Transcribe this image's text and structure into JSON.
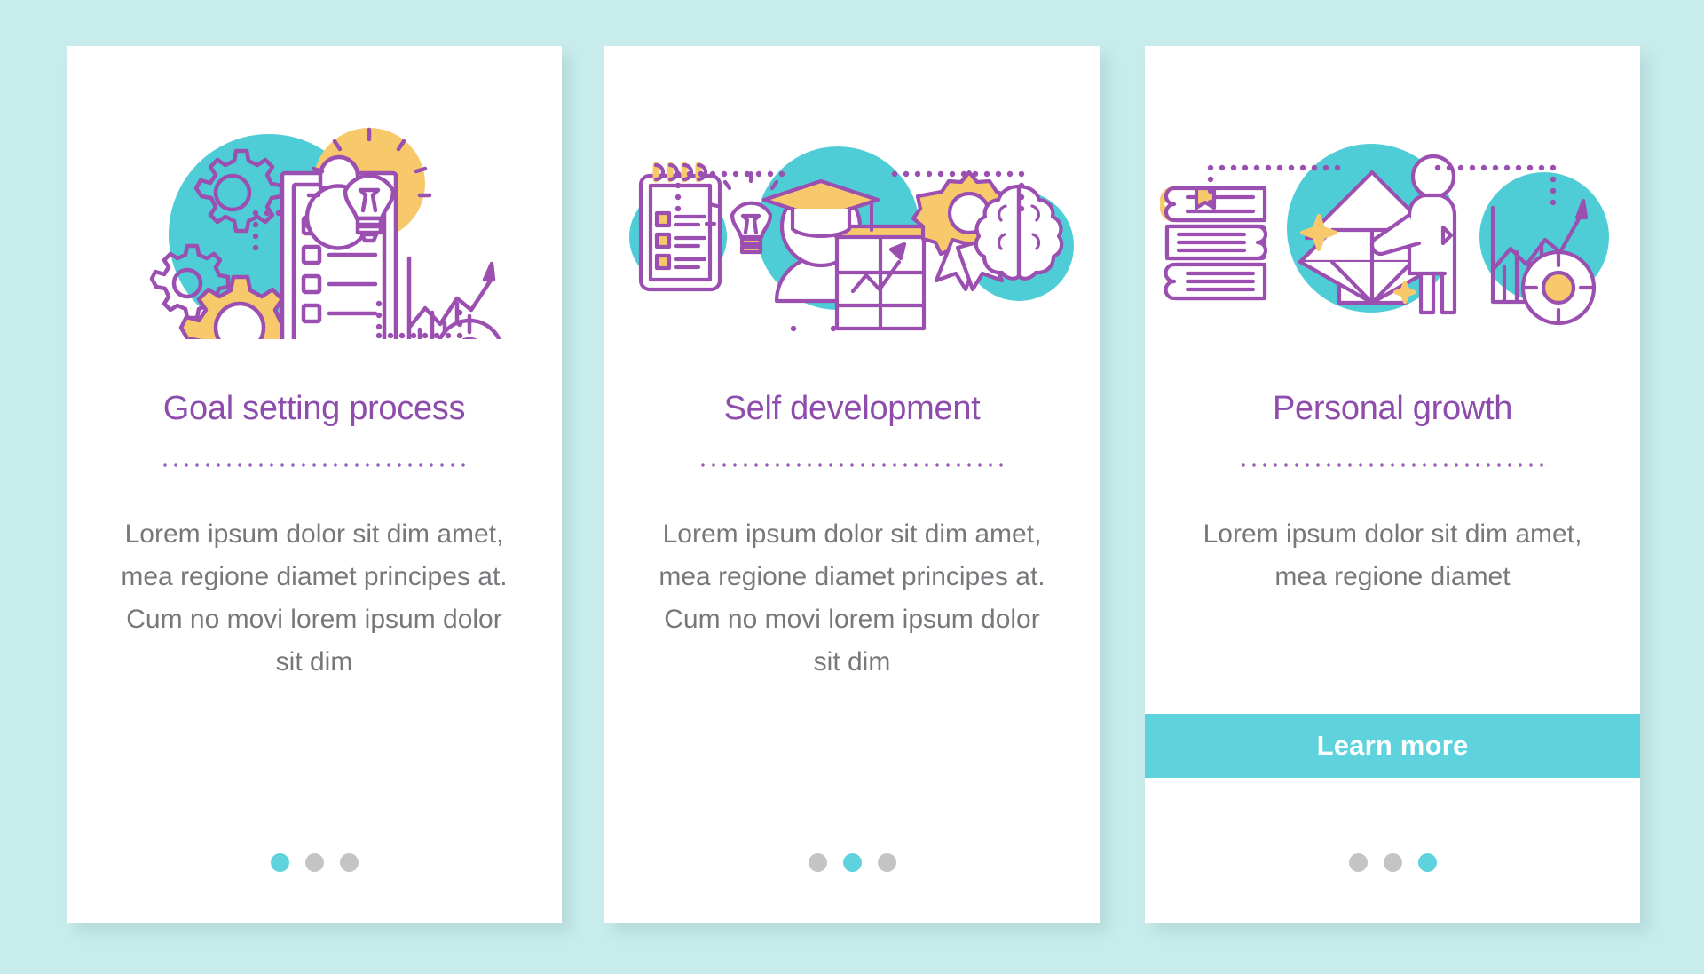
{
  "page": {
    "background_color": "#c8eceb",
    "card_background": "#ffffff",
    "title_color": "#8e4cad",
    "body_color": "#76787b",
    "accent_color": "#5ed2dd",
    "accent_yellow": "#f7c96b",
    "accent_purple": "#9b59b6",
    "dot_inactive_color": "#c4c4c4"
  },
  "cards": [
    {
      "id": "goal-setting-process",
      "title": "Goal setting process",
      "body": "Lorem ipsum dolor sit dim amet, mea regione diamet principes at. Cum no movi lorem ipsum dolor sit dim",
      "illustration_icons": [
        "gears-icon",
        "clipboard-checklist-icon",
        "lightbulb-icon",
        "bar-chart-target-icon"
      ],
      "has_button": false,
      "button_label": "",
      "dots": [
        {
          "active": true
        },
        {
          "active": false
        },
        {
          "active": false
        }
      ]
    },
    {
      "id": "self-development",
      "title": "Self development",
      "body": "Lorem ipsum dolor sit dim amet, mea regione diamet principes at. Cum no movi lorem ipsum dolor sit dim",
      "illustration_icons": [
        "notepad-checklist-icon",
        "lightbulb-icon",
        "graduate-person-whiteboard-icon",
        "award-ribbon-icon",
        "brain-icon"
      ],
      "has_button": false,
      "button_label": "",
      "dots": [
        {
          "active": false
        },
        {
          "active": true
        },
        {
          "active": false
        }
      ]
    },
    {
      "id": "personal-growth",
      "title": "Personal growth",
      "body": "Lorem ipsum dolor sit dim amet, mea regione diamet",
      "illustration_icons": [
        "book-stack-icon",
        "diamond-arrow-icon",
        "standing-person-icon",
        "growth-chart-target-icon"
      ],
      "has_button": true,
      "button_label": "Learn more",
      "dots": [
        {
          "active": false
        },
        {
          "active": false
        },
        {
          "active": true
        }
      ]
    }
  ]
}
